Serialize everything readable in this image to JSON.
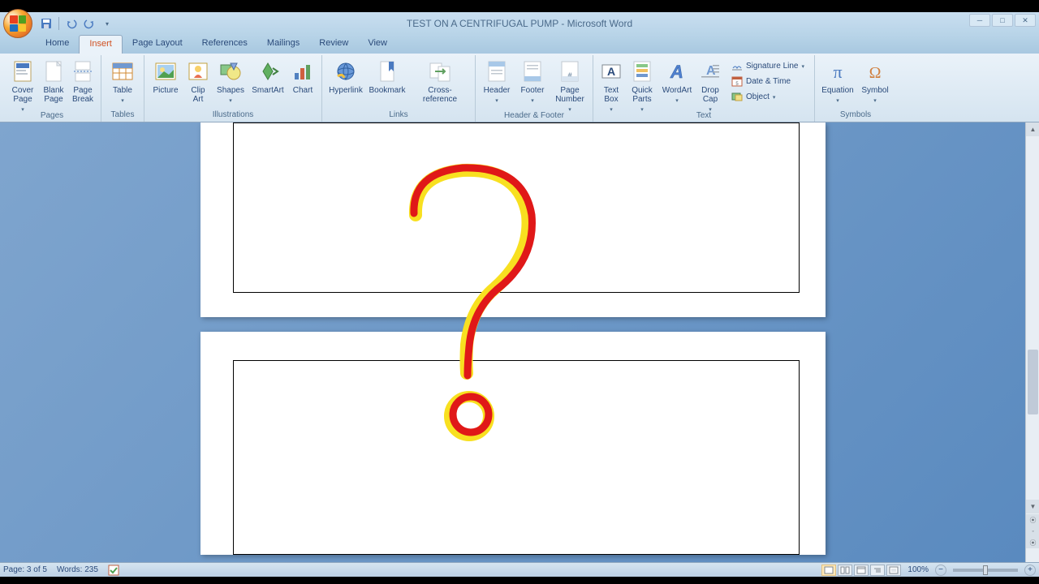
{
  "title": "TEST ON A CENTRIFUGAL PUMP - Microsoft Word",
  "tabs": [
    "Home",
    "Insert",
    "Page Layout",
    "References",
    "Mailings",
    "Review",
    "View"
  ],
  "active_tab": "Insert",
  "ribbon": {
    "pages": {
      "label": "Pages",
      "cover": "Cover Page",
      "blank": "Blank Page",
      "break": "Page Break"
    },
    "tables": {
      "label": "Tables",
      "table": "Table"
    },
    "illustrations": {
      "label": "Illustrations",
      "picture": "Picture",
      "clipart": "Clip Art",
      "shapes": "Shapes",
      "smartart": "SmartArt",
      "chart": "Chart"
    },
    "links": {
      "label": "Links",
      "hyperlink": "Hyperlink",
      "bookmark": "Bookmark",
      "crossref": "Cross-reference"
    },
    "headerfooter": {
      "label": "Header & Footer",
      "header": "Header",
      "footer": "Footer",
      "pagenum": "Page Number"
    },
    "text": {
      "label": "Text",
      "textbox": "Text Box",
      "quickparts": "Quick Parts",
      "wordart": "WordArt",
      "dropcap": "Drop Cap",
      "signature": "Signature Line",
      "datetime": "Date & Time",
      "object": "Object"
    },
    "symbols": {
      "label": "Symbols",
      "equation": "Equation",
      "symbol": "Symbol"
    }
  },
  "status": {
    "page": "Page: 3 of 5",
    "words": "Words: 235",
    "zoom": "100%"
  }
}
